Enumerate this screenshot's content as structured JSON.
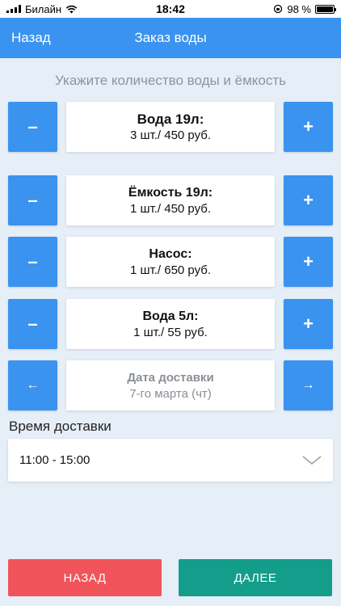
{
  "status_bar": {
    "carrier": "Билайн",
    "time": "18:42",
    "battery": "98 %",
    "battery_level": 0.98
  },
  "app_bar": {
    "back_label": "Назад",
    "title": "Заказ воды"
  },
  "subtitle": "Укажите количество воды и ёмкость",
  "items": [
    {
      "name": "Вода 19л:",
      "qty": "3 шт./ 450 руб."
    },
    {
      "name": "Ёмкость 19л:",
      "qty": "1 шт./ 450 руб."
    },
    {
      "name": "Насос:",
      "qty": "1 шт./ 650 руб."
    },
    {
      "name": "Вода 5л:",
      "qty": "1 шт./ 55 руб."
    }
  ],
  "controls": {
    "minus": "–",
    "plus": "+",
    "prev": "←",
    "next": "→"
  },
  "delivery_date": {
    "label": "Дата доставки",
    "value": "7-го марта (чт)"
  },
  "delivery_time": {
    "label": "Время доставки",
    "selected": "11:00 - 15:00"
  },
  "footer": {
    "back": "НАЗАД",
    "next": "ДАЛЕЕ"
  },
  "colors": {
    "primary": "#3a93ef",
    "danger": "#f0545a",
    "success": "#149d8a",
    "background": "#e6eef8"
  }
}
